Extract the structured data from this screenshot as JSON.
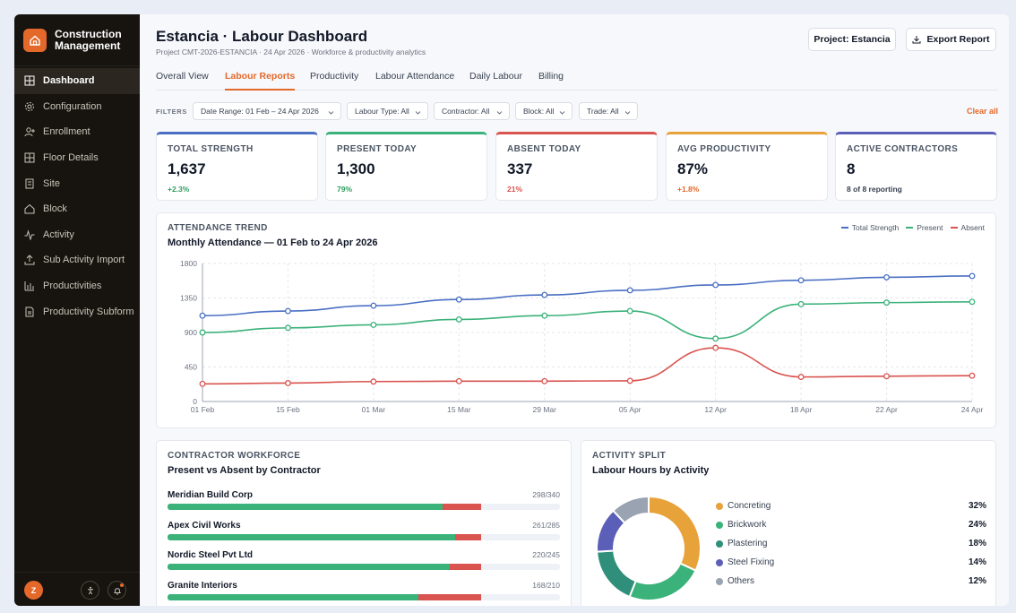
{
  "sidebar": {
    "brand_line1": "Construction",
    "brand_line2": "Management",
    "items": [
      {
        "label": "Dashboard"
      },
      {
        "label": "Configuration"
      },
      {
        "label": "Enrollment"
      },
      {
        "label": "Floor Details"
      },
      {
        "label": "Site"
      },
      {
        "label": "Block"
      },
      {
        "label": "Activity"
      },
      {
        "label": "Sub Activity Import"
      },
      {
        "label": "Productivities"
      },
      {
        "label": "Productivity Subform"
      }
    ],
    "avatar_initial": "Z"
  },
  "header": {
    "title": "Estancia · Labour Dashboard",
    "subtitle": "Project CMT-2026-ESTANCIA · 24 Apr 2026 · Workforce & productivity analytics",
    "project_button": "Project: Estancia",
    "export_button": "Export Report"
  },
  "tabs": [
    {
      "label": "Overall View"
    },
    {
      "label": "Labour Reports"
    },
    {
      "label": "Productivity"
    },
    {
      "label": "Labour Attendance"
    },
    {
      "label": "Daily Labour"
    },
    {
      "label": "Billing"
    }
  ],
  "filters": {
    "label": "FILTERS",
    "chips": [
      {
        "label": "Date Range: 01 Feb – 24 Apr 2026"
      },
      {
        "label": "Labour Type: All"
      },
      {
        "label": "Contractor: All"
      },
      {
        "label": "Block: All"
      },
      {
        "label": "Trade: All"
      }
    ],
    "clear_label": "Clear all"
  },
  "kpis": [
    {
      "label": "TOTAL STRENGTH",
      "value": "1,637",
      "sub": "+2.3%",
      "accent": "#4a6fc3",
      "sub_color": "#2f9e5f"
    },
    {
      "label": "PRESENT TODAY",
      "value": "1,300",
      "sub": "79%",
      "accent": "#3bb27a",
      "sub_color": "#2f9e5f"
    },
    {
      "label": "ABSENT TODAY",
      "value": "337",
      "sub": "21%",
      "accent": "#d9534f",
      "sub_color": "#d9534f"
    },
    {
      "label": "AVG PRODUCTIVITY",
      "value": "87%",
      "sub": "+1.8%",
      "accent": "#e8a23a",
      "sub_color": "#e4682a"
    },
    {
      "label": "ACTIVE CONTRACTORS",
      "value": "8",
      "sub": "8 of 8 reporting",
      "accent": "#5b5fb8",
      "sub_color": "#374151"
    }
  ],
  "attendance": {
    "eyebrow": "ATTENDANCE TREND",
    "title": "Monthly Attendance — 01 Feb to 24 Apr 2026"
  },
  "chart_data": {
    "type": "line",
    "x": [
      "01 Feb",
      "15 Feb",
      "01 Mar",
      "15 Mar",
      "29 Mar",
      "05 Apr",
      "12 Apr",
      "18 Apr",
      "22 Apr",
      "24 Apr"
    ],
    "yticks": [
      0,
      450,
      900,
      1350,
      1800
    ],
    "ylim": [
      0,
      1800
    ],
    "grid": true,
    "legend_position": "top-right",
    "series": [
      {
        "name": "Total Strength",
        "color": "#4a6fc3",
        "values": [
          1120,
          1180,
          1250,
          1330,
          1390,
          1450,
          1520,
          1580,
          1620,
          1637
        ]
      },
      {
        "name": "Present",
        "color": "#3bb27a",
        "values": [
          900,
          960,
          1000,
          1070,
          1120,
          1180,
          820,
          1270,
          1290,
          1300
        ]
      },
      {
        "name": "Absent",
        "color": "#d9534f",
        "values": [
          230,
          240,
          260,
          265,
          265,
          270,
          700,
          320,
          330,
          337
        ]
      }
    ]
  },
  "contractors": {
    "eyebrow": "CONTRACTOR WORKFORCE",
    "title": "Present vs Absent by Contractor",
    "present_color": "#3bb27a",
    "absent_color": "#d9534f",
    "rows": [
      {
        "name": "Meridian Build Corp",
        "count": "298/340",
        "present": 298,
        "total": 340
      },
      {
        "name": "Apex Civil Works",
        "count": "261/285",
        "present": 261,
        "total": 285
      },
      {
        "name": "Nordic Steel Pvt Ltd",
        "count": "220/245",
        "present": 220,
        "total": 245
      },
      {
        "name": "Granite Interiors",
        "count": "168/210",
        "present": 168,
        "total": 210
      }
    ]
  },
  "activity": {
    "eyebrow": "ACTIVITY SPLIT",
    "title": "Labour Hours by Activity",
    "items": [
      {
        "label": "Concreting",
        "pct": "32%",
        "value": 32,
        "color": "#e8a23a"
      },
      {
        "label": "Brickwork",
        "pct": "24%",
        "value": 24,
        "color": "#3bb27a"
      },
      {
        "label": "Plastering",
        "pct": "18%",
        "value": 18,
        "color": "#2f8f7a"
      },
      {
        "label": "Steel Fixing",
        "pct": "14%",
        "value": 14,
        "color": "#5b5fb8"
      },
      {
        "label": "Others",
        "pct": "12%",
        "value": 12,
        "color": "#9aa3b2"
      }
    ]
  }
}
